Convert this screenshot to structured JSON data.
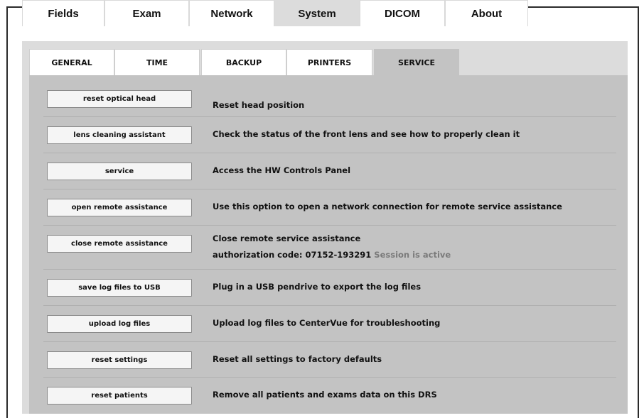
{
  "main_tabs": [
    {
      "label": "Fields",
      "active": false
    },
    {
      "label": "Exam",
      "active": false
    },
    {
      "label": "Network",
      "active": false
    },
    {
      "label": "System",
      "active": true
    },
    {
      "label": "DICOM",
      "active": false
    },
    {
      "label": "About",
      "active": false
    }
  ],
  "sub_tabs": [
    {
      "label": "GENERAL",
      "active": false
    },
    {
      "label": "TIME",
      "active": false
    },
    {
      "label": "BACKUP",
      "active": false
    },
    {
      "label": "PRINTERS",
      "active": false
    },
    {
      "label": "SERVICE",
      "active": true
    }
  ],
  "service_rows": [
    {
      "button": "reset optical head",
      "description": "Reset head position"
    },
    {
      "button": "lens cleaning assistant",
      "description": "Check the status of the front lens and see how to properly clean it"
    },
    {
      "button": "service",
      "description": "Access the HW Controls Panel"
    },
    {
      "button": "open remote assistance",
      "description": "Use this option to open a network connection for remote service assistance"
    },
    {
      "button": "close remote assistance",
      "description": "Close remote service assistance",
      "auth_label": "authorization code: 07152-193291",
      "status": "Session is active"
    },
    {
      "button": "save log files to USB",
      "description": "Plug in a USB pendrive to export the log files"
    },
    {
      "button": "upload log files",
      "description": "Upload log files to CenterVue for troubleshooting"
    },
    {
      "button": "reset settings",
      "description": "Reset all settings to factory defaults"
    },
    {
      "button": "reset patients",
      "description": "Remove all patients and exams data on this DRS"
    }
  ],
  "colors": {
    "main_tab_active_bg": "#dcdcdc",
    "panel_bg": "#dcdcdc",
    "sub_tab_active_bg": "#c3c3c3",
    "content_bg": "#c3c3c3",
    "status_text": "#7a7a7a"
  }
}
